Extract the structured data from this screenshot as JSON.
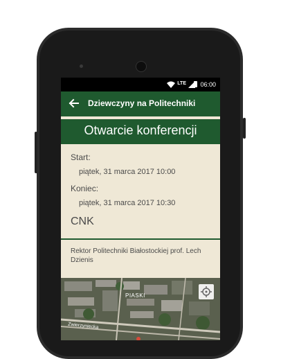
{
  "status_bar": {
    "network": "LTE",
    "time": "06:00"
  },
  "app_bar": {
    "title": "Dziewczyny na Politechniki"
  },
  "event": {
    "title": "Otwarcie konferencji",
    "start_label": "Start:",
    "start_value": "piątek, 31 marca 2017 10:00",
    "end_label": "Koniec:",
    "end_value": "piątek, 31 marca 2017 10:30",
    "location": "CNK",
    "description": "Rektor Politechniki Białostockiej prof. Lech Dzienis"
  },
  "map": {
    "place_label": "PIASKI",
    "street_label": "Zwierzyniecka"
  },
  "colors": {
    "primary": "#1f5a2f",
    "background": "#efe8d6",
    "text": "#4a4a4a"
  }
}
